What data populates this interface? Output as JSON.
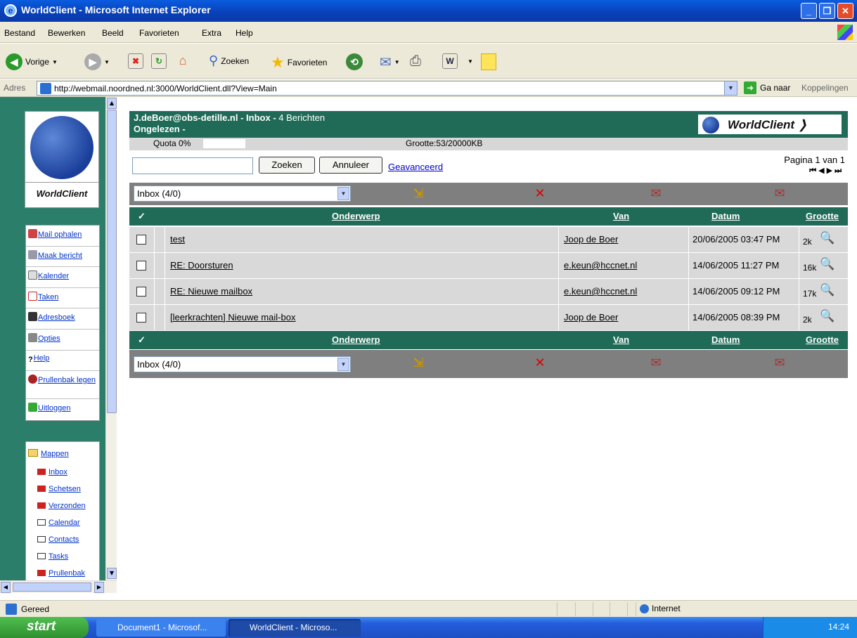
{
  "window": {
    "title": "WorldClient - Microsoft Internet Explorer"
  },
  "menu": [
    "Bestand",
    "Bewerken",
    "Beeld",
    "Favorieten",
    "Extra",
    "Help"
  ],
  "toolbar": {
    "back": "Vorige",
    "search": "Zoeken",
    "favorites": "Favorieten"
  },
  "address": {
    "label": "Adres",
    "url": "http://webmail.noordned.nl:3000/WorldClient.dll?View=Main",
    "go": "Ga naar",
    "links": "Koppelingen"
  },
  "sidebar": {
    "logo": "WorldClient",
    "nav": [
      {
        "label": "Mail ophalen",
        "icon": "mail-fetch-icon"
      },
      {
        "label": "Maak bericht",
        "icon": "compose-icon"
      },
      {
        "label": "Kalender",
        "icon": "calendar-icon"
      },
      {
        "label": "Taken",
        "icon": "tasks-icon"
      },
      {
        "label": "Adresboek",
        "icon": "addressbook-icon"
      },
      {
        "label": "Opties",
        "icon": "options-icon"
      },
      {
        "label": "Help",
        "icon": "help-icon"
      },
      {
        "label": "Prullenbak legen",
        "icon": "empty-trash-icon"
      },
      {
        "label": "Uitloggen",
        "icon": "logout-icon"
      }
    ],
    "folders_header": "Mappen",
    "folders": [
      "Inbox",
      "Schetsen",
      "Verzonden",
      "Calendar",
      "Contacts",
      "Tasks",
      "Prullenbak"
    ]
  },
  "main": {
    "account": "J.deBoer@obs-detille.nl",
    "folder_info": "- Inbox -",
    "count": "4 Berichten",
    "unread": "Ongelezen -",
    "quota": "Quota 0%",
    "size": "Grootte:53/20000KB",
    "logo": "WorldClient",
    "search_button": "Zoeken",
    "cancel_button": "Annuleer",
    "advanced": "Geavanceerd",
    "page_info": "Pagina 1 van 1",
    "folder_select": "Inbox (4/0)",
    "columns": {
      "check": "✓",
      "subject": "Onderwerp",
      "from": "Van",
      "date": "Datum",
      "size": "Grootte"
    },
    "messages": [
      {
        "subject": "test",
        "from": "Joop de Boer",
        "date": "20/06/2005 03:47 PM",
        "size": "2k"
      },
      {
        "subject": "RE: Doorsturen",
        "from": "e.keun@hccnet.nl",
        "date": "14/06/2005 11:27 PM",
        "size": "16k"
      },
      {
        "subject": "RE: Nieuwe mailbox",
        "from": "e.keun@hccnet.nl",
        "date": "14/06/2005 09:12 PM",
        "size": "17k"
      },
      {
        "subject": "[leerkrachten] Nieuwe mail-box",
        "from": "Joop de Boer",
        "date": "14/06/2005 08:39 PM",
        "size": "2k"
      }
    ]
  },
  "status": {
    "text": "Gereed",
    "zone": "Internet"
  },
  "taskbar": {
    "start": "start",
    "tasks": [
      "Document1 - Microsof...",
      "WorldClient - Microso..."
    ],
    "clock": "14:24"
  }
}
